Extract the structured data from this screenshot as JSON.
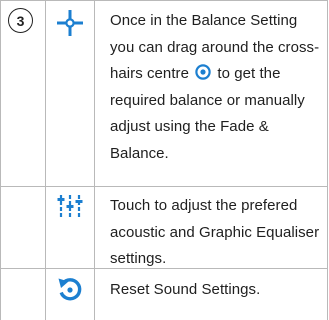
{
  "rows": [
    {
      "number": "3",
      "icon": "balance-crosshair-icon",
      "text_before": "Once in the Balance Setting you can drag around the cross-hairs centre",
      "inline_icon": "target-dot-icon",
      "text_after": "to get the required balance or manually adjust using the Fade & Balance."
    },
    {
      "number": "",
      "icon": "equaliser-sliders-icon",
      "text": "Touch to adjust the prefered acoustic and Graphic Equaliser settings."
    },
    {
      "number": "",
      "icon": "reset-arrow-icon",
      "text": "Reset Sound Settings."
    }
  ],
  "colors": {
    "accent": "#1c7fd0",
    "grid": "#b9b9b9",
    "text": "#1f1f1f"
  }
}
